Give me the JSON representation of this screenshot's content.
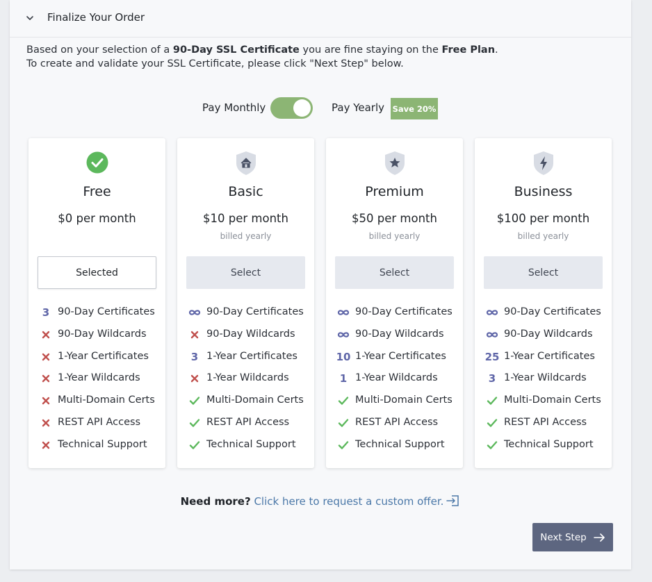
{
  "section": {
    "title": "Finalize Your Order"
  },
  "intro": {
    "p1": "Based on your selection of a ",
    "cert": "90-Day SSL Certificate",
    "p2": " you are fine staying on the ",
    "plan": "Free Plan",
    "p3": ".",
    "line2": "To create and validate your SSL Certificate, please click \"Next Step\" below."
  },
  "billing": {
    "monthly_label": "Pay Monthly",
    "yearly_label": "Pay Yearly",
    "save_badge": "Save 20%",
    "toggle_state": "yearly"
  },
  "colors": {
    "accent_green": "#8cb574",
    "cross_red": "#c0504d",
    "check_green": "#5cb85c",
    "number_purple": "#5f66a8",
    "link_blue": "#4b78a8",
    "next_button": "#5d6680"
  },
  "plans": [
    {
      "icon": "check-circle-icon",
      "name": "Free",
      "price": "$0 per month",
      "billed": "",
      "button": "Selected",
      "selected": true,
      "features": [
        {
          "mark": "3",
          "label": "90-Day Certificates"
        },
        {
          "mark": "cross",
          "label": "90-Day Wildcards"
        },
        {
          "mark": "cross",
          "label": "1-Year Certificates"
        },
        {
          "mark": "cross",
          "label": "1-Year Wildcards"
        },
        {
          "mark": "cross",
          "label": "Multi-Domain Certs"
        },
        {
          "mark": "cross",
          "label": "REST API Access"
        },
        {
          "mark": "cross",
          "label": "Technical Support"
        }
      ]
    },
    {
      "icon": "home-shield-icon",
      "name": "Basic",
      "price": "$10 per month",
      "billed": "billed yearly",
      "button": "Select",
      "selected": false,
      "features": [
        {
          "mark": "infinity",
          "label": "90-Day Certificates"
        },
        {
          "mark": "cross",
          "label": "90-Day Wildcards"
        },
        {
          "mark": "3",
          "label": "1-Year Certificates"
        },
        {
          "mark": "cross",
          "label": "1-Year Wildcards"
        },
        {
          "mark": "check",
          "label": "Multi-Domain Certs"
        },
        {
          "mark": "check",
          "label": "REST API Access"
        },
        {
          "mark": "check",
          "label": "Technical Support"
        }
      ]
    },
    {
      "icon": "star-shield-icon",
      "name": "Premium",
      "price": "$50 per month",
      "billed": "billed yearly",
      "button": "Select",
      "selected": false,
      "features": [
        {
          "mark": "infinity",
          "label": "90-Day Certificates"
        },
        {
          "mark": "infinity",
          "label": "90-Day Wildcards"
        },
        {
          "mark": "10",
          "label": "1-Year Certificates"
        },
        {
          "mark": "1",
          "label": "1-Year Wildcards"
        },
        {
          "mark": "check",
          "label": "Multi-Domain Certs"
        },
        {
          "mark": "check",
          "label": "REST API Access"
        },
        {
          "mark": "check",
          "label": "Technical Support"
        }
      ]
    },
    {
      "icon": "bolt-shield-icon",
      "name": "Business",
      "price": "$100 per month",
      "billed": "billed yearly",
      "button": "Select",
      "selected": false,
      "features": [
        {
          "mark": "infinity",
          "label": "90-Day Certificates"
        },
        {
          "mark": "infinity",
          "label": "90-Day Wildcards"
        },
        {
          "mark": "25",
          "label": "1-Year Certificates"
        },
        {
          "mark": "3",
          "label": "1-Year Wildcards"
        },
        {
          "mark": "check",
          "label": "Multi-Domain Certs"
        },
        {
          "mark": "check",
          "label": "REST API Access"
        },
        {
          "mark": "check",
          "label": "Technical Support"
        }
      ]
    }
  ],
  "custom_offer": {
    "prefix": "Need more?",
    "link": "Click here to request a custom offer.",
    "icon": "external-enter-icon"
  },
  "next_button": {
    "label": "Next Step",
    "icon": "arrow-right-icon"
  }
}
